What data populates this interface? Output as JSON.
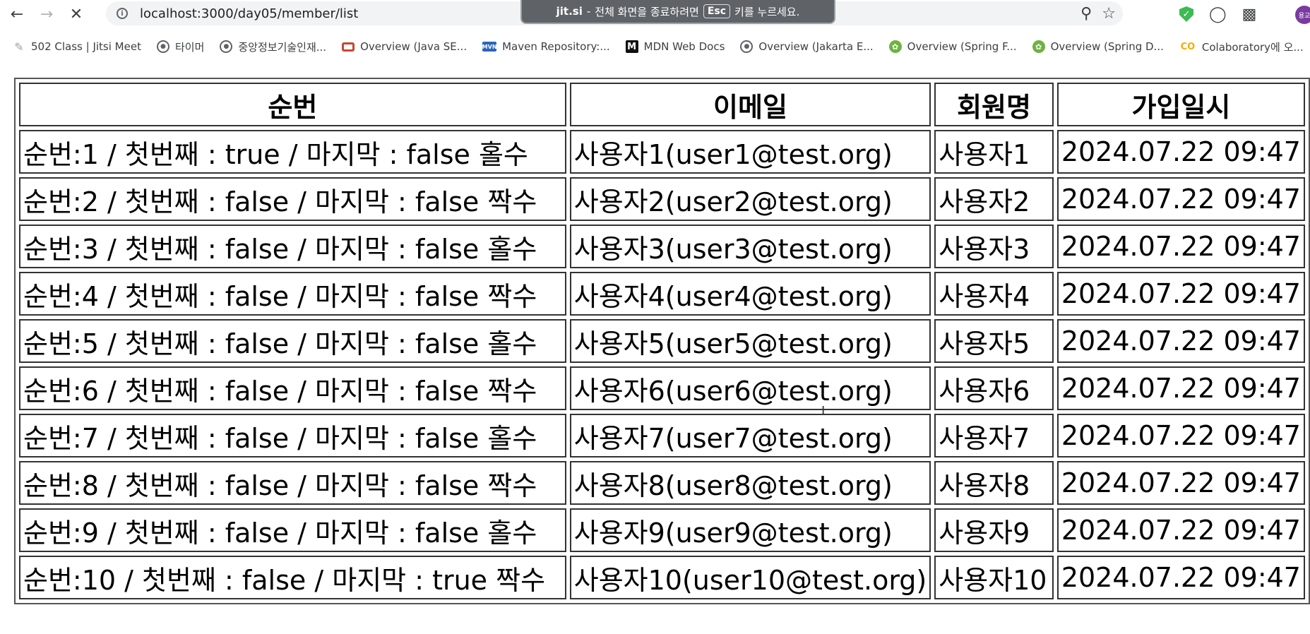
{
  "browser": {
    "url": "localhost:3000/day05/member/list",
    "fullscreen_banner": {
      "app": "jit.si",
      "separator": "-",
      "message_before": "전체 화면을 종료하려면",
      "key": "Esc",
      "message_after": "키를 누르세요."
    },
    "icons": {
      "back": "back-arrow-icon",
      "forward": "forward-arrow-icon",
      "stop": "stop-loading-icon",
      "zoom": "zoom-icon",
      "bookmark_star": "bookmark-star-icon",
      "extension": "puzzle-extension-icon"
    },
    "profile_label": "용교"
  },
  "bookmarks": [
    {
      "label": "502 Class | Jitsi Meet",
      "icon": "jitsi"
    },
    {
      "label": "타이머",
      "icon": "globe"
    },
    {
      "label": "중앙정보기술인재...",
      "icon": "globe"
    },
    {
      "label": "Overview (Java SE...",
      "icon": "oracle"
    },
    {
      "label": "Maven Repository:...",
      "icon": "mvn"
    },
    {
      "label": "MDN Web Docs",
      "icon": "mdn"
    },
    {
      "label": "Overview (Jakarta E...",
      "icon": "globe"
    },
    {
      "label": "Overview (Spring F...",
      "icon": "spring"
    },
    {
      "label": "Overview (Spring D...",
      "icon": "spring"
    },
    {
      "label": "Colaboratory에 오...",
      "icon": "colab"
    }
  ],
  "table": {
    "headers": [
      "순번",
      "이메일",
      "회원명",
      "가입일시"
    ],
    "rows": [
      [
        "순번:1 / 첫번째 : true / 마지막 : false 홀수",
        "사용자1(user1@test.org)",
        "사용자1",
        "2024.07.22 09:47"
      ],
      [
        "순번:2 / 첫번째 : false / 마지막 : false 짝수",
        "사용자2(user2@test.org)",
        "사용자2",
        "2024.07.22 09:47"
      ],
      [
        "순번:3 / 첫번째 : false / 마지막 : false 홀수",
        "사용자3(user3@test.org)",
        "사용자3",
        "2024.07.22 09:47"
      ],
      [
        "순번:4 / 첫번째 : false / 마지막 : false 짝수",
        "사용자4(user4@test.org)",
        "사용자4",
        "2024.07.22 09:47"
      ],
      [
        "순번:5 / 첫번째 : false / 마지막 : false 홀수",
        "사용자5(user5@test.org)",
        "사용자5",
        "2024.07.22 09:47"
      ],
      [
        "순번:6 / 첫번째 : false / 마지막 : false 짝수",
        "사용자6(user6@test.org)",
        "사용자6",
        "2024.07.22 09:47"
      ],
      [
        "순번:7 / 첫번째 : false / 마지막 : false 홀수",
        "사용자7(user7@test.org)",
        "사용자7",
        "2024.07.22 09:47"
      ],
      [
        "순번:8 / 첫번째 : false / 마지막 : false 짝수",
        "사용자8(user8@test.org)",
        "사용자8",
        "2024.07.22 09:47"
      ],
      [
        "순번:9 / 첫번째 : false / 마지막 : false 홀수",
        "사용자9(user9@test.org)",
        "사용자9",
        "2024.07.22 09:47"
      ],
      [
        "순번:10 / 첫번째 : false / 마지막 : true 짝수",
        "사용자10(user10@test.org)",
        "사용자10",
        "2024.07.22 09:47"
      ]
    ]
  }
}
